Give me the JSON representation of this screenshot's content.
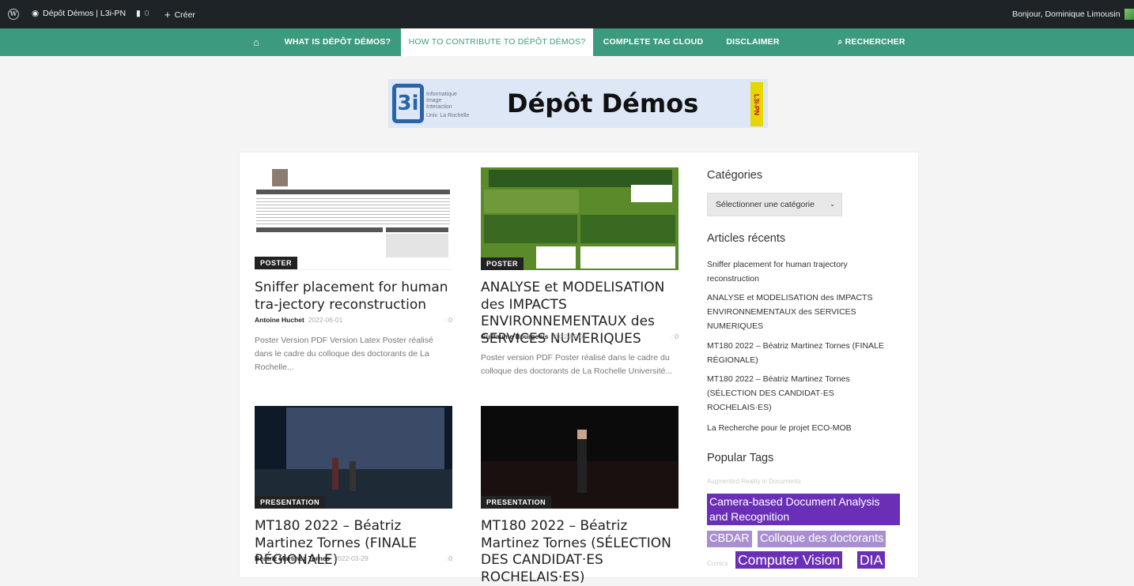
{
  "adminbar": {
    "site_name": "Dépôt Démos | L3i-PN",
    "comments_count": "0",
    "create_label": "Créer",
    "greeting": "Bonjour, Dominique Limousin"
  },
  "nav": {
    "items": [
      {
        "label": "WHAT IS DÉPÔT DÉMOS?"
      },
      {
        "label": "HOW TO CONTRIBUTE TO DÉPÔT DÉMOS?"
      },
      {
        "label": "COMPLETE TAG CLOUD"
      },
      {
        "label": "DISCLAIMER"
      },
      {
        "label": "RECHERCHER"
      }
    ]
  },
  "logo": {
    "sub": "Informatique Image Interaction",
    "sub2": "Univ. La Rochelle",
    "title": "Dépôt Démos",
    "tag": "L3i-PN"
  },
  "posts": [
    {
      "category": "POSTER",
      "title": "Sniffer placement for human tra-jectory reconstruction",
      "author": "Antoine Huchet",
      "date": "2022-06-01",
      "comments": "0",
      "excerpt": "Poster Version PDF Version Latex Poster réalisé dans le cadre du colloque des doctorants de La Rochelle..."
    },
    {
      "category": "POSTER",
      "title": "ANALYSE et MODELISATION des IMPACTS ENVIRONNEMENTAUX des SERVICES NUMERIQUES",
      "author": "Guillaume Bourgeois",
      "date": "2022-06-01",
      "comments": "0",
      "excerpt": "Poster version PDF Poster réalisé dans le cadre du colloque des doctorants de La Rochelle Université..."
    },
    {
      "category": "PRESENTATION",
      "title": "MT180 2022 – Béatriz Martinez Tornes (FINALE RÉGIONALE)",
      "author": "Beatriz Martinez Tornes",
      "date": "2022-03-29",
      "comments": "0"
    },
    {
      "category": "PRESENTATION",
      "title": "MT180 2022 – Béatriz Martinez Tornes (SÉLECTION DES CANDIDAT·ES ROCHELAIS·ES)"
    }
  ],
  "sidebar": {
    "categories_title": "Catégories",
    "categories_select": "Sélectionner une catégorie",
    "recent_title": "Articles récents",
    "recent": [
      "Sniffer placement for human trajectory reconstruction",
      "ANALYSE et MODELISATION des IMPACTS ENVIRONNEMENTAUX des SERVICES NUMERIQUES",
      "MT180 2022 – Béatriz Martinez Tornes (FINALE RÉGIONALE)",
      "MT180 2022 – Béatriz Martinez Tornes (SÉLECTION DES CANDIDAT·ES ROCHELAIS·ES)",
      "La Recherche pour le projet ECO-MOB"
    ],
    "tags_title": "Popular Tags",
    "tags": [
      "Augmented Reality in Documents",
      "Camera-based Document Analysis and Recognition",
      "CBDAR",
      "Colloque des doctorants",
      "Comics",
      "Computer Vision",
      "DIA"
    ]
  },
  "colors": {
    "adminbar": "#1d2327",
    "nav": "#3c9b7f",
    "tag_dark": "#6a2fb6",
    "tag_light": "#a98fd0"
  }
}
